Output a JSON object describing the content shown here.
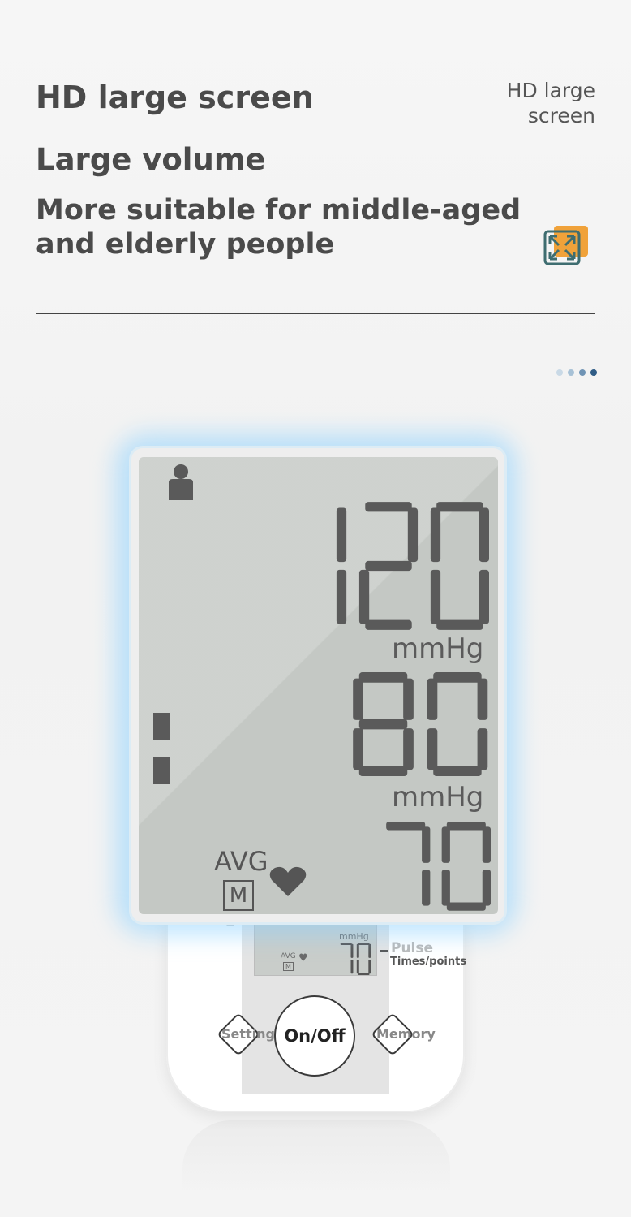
{
  "header": {
    "line1": "HD large screen",
    "line2": "Large volume",
    "line3": "More suitable for middle-aged and elderly people",
    "corner_label": "HD large screen",
    "icon": "expand-screen-icon"
  },
  "pager": {
    "count": 4,
    "active_index": 3,
    "colors": [
      "#c9d9e6",
      "#a7c1d6",
      "#6f93b4",
      "#2f5c86"
    ]
  },
  "display": {
    "systolic": "120",
    "systolic_unit": "mmHg",
    "diastolic": "80",
    "diastolic_unit": "mmHg",
    "pulse": "70",
    "avg_label": "AVG",
    "memory_indicator": "M",
    "icons": [
      "user-icon",
      "heart-icon",
      "level-bars-icon"
    ]
  },
  "device": {
    "small_unit": "mmHg",
    "small_avg": "AVG",
    "small_m": "M",
    "small_pulse": "70",
    "pulse_label": "Pulse",
    "pulse_sublabel": "Times/points",
    "onoff_label": "On/Off",
    "settings_label": "Settings",
    "memory_label": "Memory"
  },
  "colors": {
    "lcd": "#c4c8c4",
    "digit": "#5a5a5a",
    "glow": "#8cd2ff",
    "icon_orange": "#f0a23a",
    "icon_teal": "#3e6d70"
  }
}
